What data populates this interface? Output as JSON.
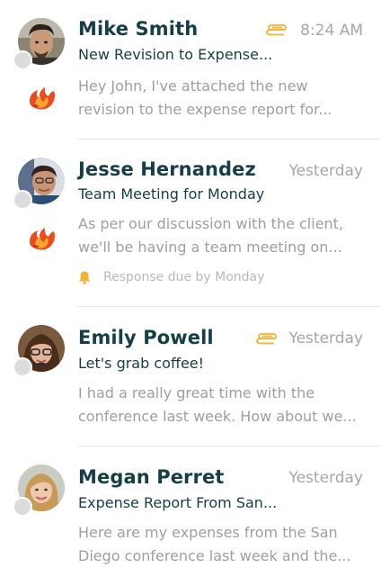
{
  "messages": [
    {
      "sender": "Mike Smith",
      "time": "8:24 AM",
      "subject": "New Revision to Expense...",
      "preview_lines": [
        "Hey John, I've attached the new",
        "revision to the expense report for..."
      ],
      "has_attachment": true,
      "avatar": "mike-smith-avatar"
    },
    {
      "sender": "Jesse Hernandez",
      "time": "Yesterday",
      "subject": "Team Meeting for Monday",
      "preview_lines": [
        "As per our discussion with the client,",
        "we'll be having a team meeting on..."
      ],
      "due_text": "Response due by Monday",
      "avatar": "jesse-hernandez-avatar"
    },
    {
      "sender": "Emily Powell",
      "time": "Yesterday",
      "subject": "Let's grab coffee!",
      "preview_lines": [
        "I had a really great time with the",
        "conference last week. How about we..."
      ],
      "has_attachment": true,
      "avatar": "emily-powell-avatar"
    },
    {
      "sender": "Megan Perret",
      "time": "Yesterday",
      "subject": "Expense Report From San...",
      "preview_lines": [
        "Here are my expenses from the San",
        "Diego conference last week and the..."
      ],
      "avatar": "megan-perret-avatar"
    }
  ],
  "colors": {
    "name": "#153e45",
    "meta": "#a6a6a6",
    "attachment": "#f2b233",
    "bell": "#f2b233",
    "flame": "#e84c1f"
  }
}
